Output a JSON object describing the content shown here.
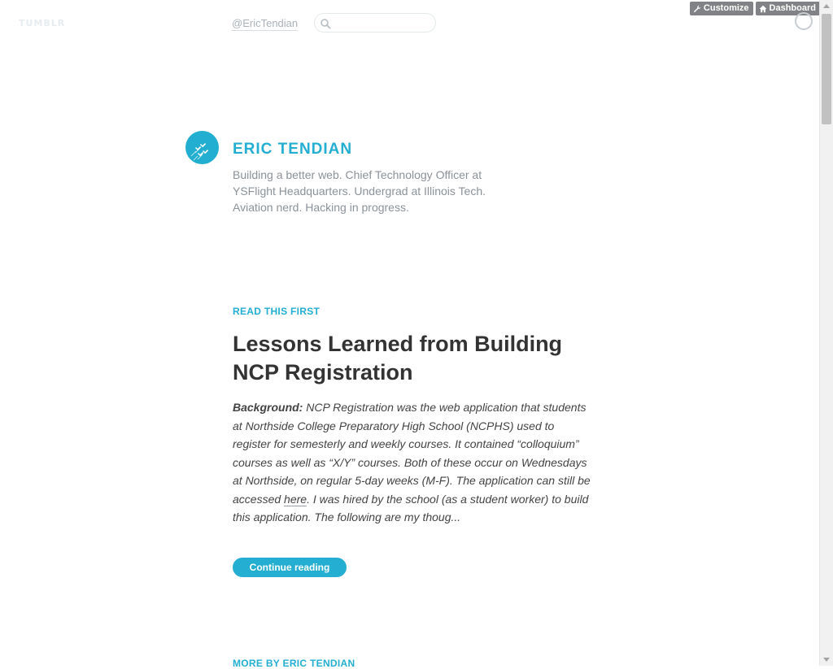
{
  "topbar": {
    "logo": "TUMBLR",
    "handle": "@EricTendian",
    "search_placeholder": "",
    "customize_label": "Customize",
    "dashboard_label": "Dashboard"
  },
  "blog": {
    "title": "ERIC TENDIAN",
    "description": "Building a better web. Chief Technology Officer at YSFlight Headquarters. Undergrad at Illinois Tech. Aviation nerd. Hacking in progress.",
    "accent_color": "#23aed2"
  },
  "post": {
    "label": "READ THIS FIRST",
    "title": "Lessons Learned from Building NCP Registration",
    "body_lead": "Background:",
    "body_part1": " NCP Registration was the web application that students at Northside College Preparatory High School (NCPHS) used to register for semesterly and weekly courses. It contained “colloquium” courses as well as “X/Y” courses. Both of these occur on Wednesdays at Northside, on regular 5-day weeks (M-F). The application can still be accessed ",
    "body_link": "here",
    "body_part2": ". I was hired by the school (as a student worker) to build this application. The following are my thoug...",
    "continue_label": "Continue reading"
  },
  "footer": {
    "more_by": "MORE BY ERIC TENDIAN"
  }
}
